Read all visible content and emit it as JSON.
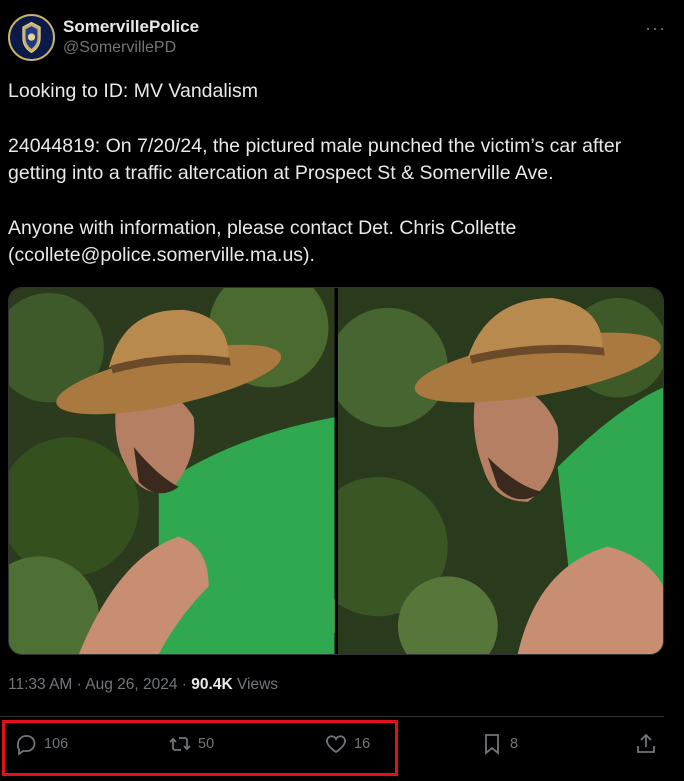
{
  "header": {
    "display_name": "SomervillePolice",
    "handle": "@SomervillePD",
    "more_label": "···"
  },
  "tweet": {
    "line1": "Looking to ID: MV Vandalism",
    "line2": "24044819: On 7/20/24, the pictured male punched the victim’s car after getting into a traffic altercation at Prospect St & Somerville Ave.",
    "line3": "Anyone with information, please contact Det. Chris Collette (ccollete@police.somerville.ma.us)."
  },
  "meta": {
    "time": "11:33 AM",
    "sep": " · ",
    "date": "Aug 26, 2024",
    "sep2": " · ",
    "views_count": "90.4K",
    "views_label": " Views"
  },
  "actions": {
    "reply_count": "106",
    "retweet_count": "50",
    "like_count": "16",
    "bookmark_count": "8"
  },
  "colors": {
    "background": "#000000",
    "text": "#e7e9ea",
    "muted": "#71767b",
    "highlight_box": "#e1101c"
  },
  "icons": [
    "more-icon",
    "reply-icon",
    "retweet-icon",
    "like-icon",
    "bookmark-icon",
    "share-icon"
  ]
}
